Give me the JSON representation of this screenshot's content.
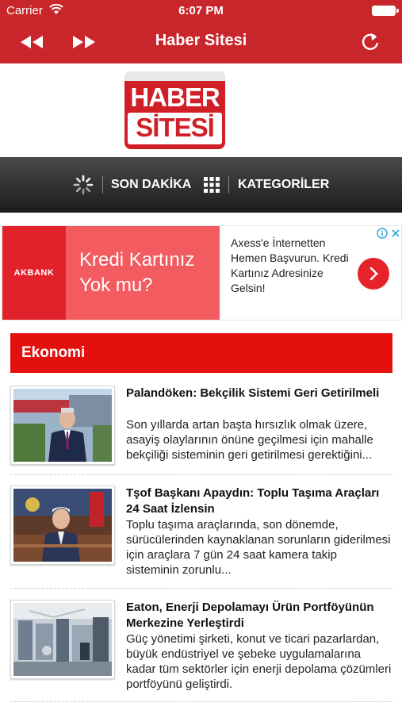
{
  "status_bar": {
    "carrier": "Carrier",
    "time": "6:07 PM"
  },
  "nav": {
    "title": "Haber Sitesi"
  },
  "logo": {
    "line1": "HABER",
    "line2": "SİTESİ"
  },
  "menu": {
    "son_dakika": "SON DAKİKA",
    "kategoriler": "KATEGORİLER"
  },
  "ad": {
    "brand": "AKBANK",
    "headline": "Kredi Kartınız Yok mu?",
    "body": "Axess'e İnternetten Hemen Başvurun. Kredi Kartınız Adresinize Gelsin!"
  },
  "section": {
    "title": "Ekonomi"
  },
  "articles": [
    {
      "title": "Palandöken: Bekçilik Sistemi Geri Getirilmeli",
      "summary": "Son yıllarda artan başta hırsızlık olmak üzere, asayiş olaylarının önüne geçilmesi için mahalle bekçiliği sisteminin geri getirilmesi gerektiğini..."
    },
    {
      "title": "Tşof Başkanı Apaydın: Toplu Taşıma Araçları 24 Saat İzlensin",
      "summary": "Toplu taşıma araçlarında, son dönemde, sürücülerinden kaynaklanan sorunların giderilmesi için araçlara 7 gün 24 saat kamera takip sisteminin zorunlu..."
    },
    {
      "title": "Eaton, Enerji Depolamayı Ürün Portföyünün Merkezine Yerleştirdi",
      "summary": "Güç yönetimi şirketi, konut ve ticari pazarlardan, büyük endüstriyel ve şebeke uygulamalarına kadar tüm sektörler için enerji depolama çözümleri portföyünü geliştirdi."
    }
  ],
  "colors": {
    "nav_bg": "#c8262a",
    "section_bg": "#e3100f",
    "ad_bank": "#e2222b",
    "ad_headline_bg": "#f25b5f"
  },
  "icons": [
    "wifi-icon",
    "battery-icon",
    "rewind-icon",
    "fast-forward-icon",
    "refresh-icon",
    "loading-spinner-icon",
    "grid-icon",
    "ad-info-icon",
    "ad-close-icon",
    "chevron-right-icon"
  ]
}
